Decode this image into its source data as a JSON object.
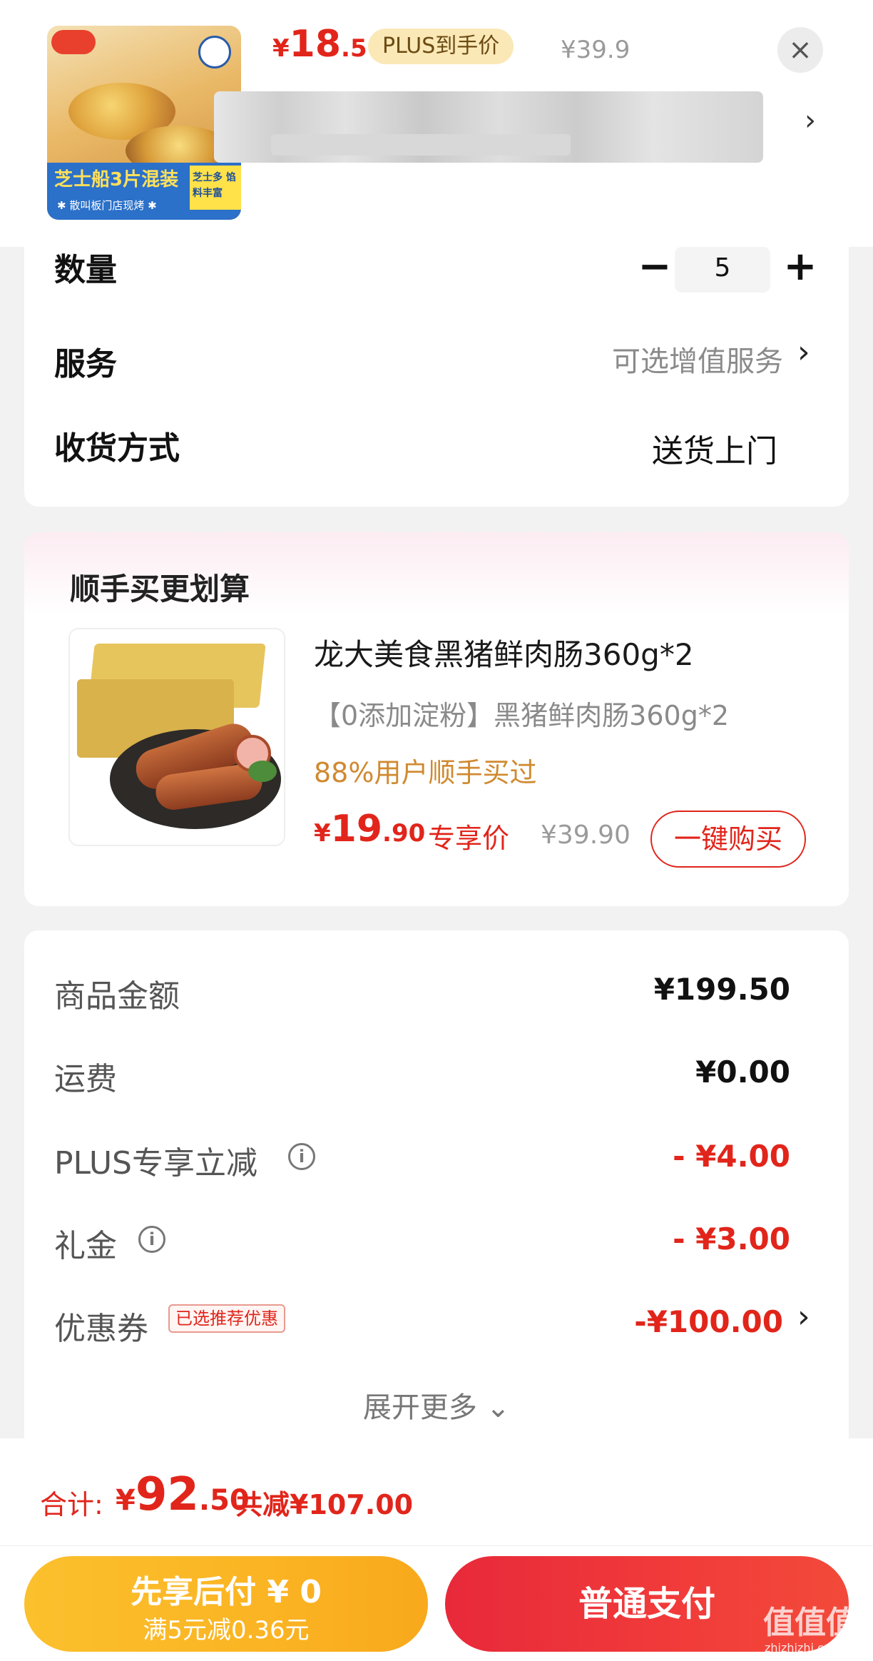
{
  "header": {
    "product_image_texts": {
      "banner_title": "芝士船3片混装",
      "banner_sub": "✱ 散叫板门店现烤 ✱",
      "side_tag": "芝士多 馅料丰富"
    },
    "price_currency": "¥",
    "price_integer": "18",
    "price_decimal": ".5",
    "plus_tag": "PLUS到手价",
    "original_price": "¥39.9",
    "close_icon": "×",
    "chevron": "›"
  },
  "options": {
    "quantity_label": "数量",
    "quantity_minus": "−",
    "quantity_value": "5",
    "quantity_plus": "+",
    "service_label": "服务",
    "service_value": "可选增值服务",
    "service_chevron": "›",
    "delivery_label": "收货方式",
    "delivery_value": "送货上门"
  },
  "suggestion": {
    "title": "顺手买更划算",
    "product_name": "龙大美食黑猪鲜肉肠360g*2",
    "product_desc": "【0添加淀粉】黑猪鲜肉肠360g*2",
    "purchase_rate": "88%用户顺手买过",
    "price_currency": "¥",
    "price_integer": "19",
    "price_decimal": ".90",
    "exclusive_label": "专享价",
    "original_price": "¥39.90",
    "buy_button": "一键购买"
  },
  "amounts": {
    "goods_label": "商品金额",
    "goods_value": "¥199.50",
    "shipping_label": "运费",
    "shipping_value": "¥0.00",
    "plus_discount_label": "PLUS专享立减",
    "plus_discount_value": "- ¥4.00",
    "gift_label": "礼金",
    "gift_value": "- ¥3.00",
    "coupon_label": "优惠券",
    "coupon_tag": "已选推荐优惠",
    "coupon_value": "-¥100.00",
    "coupon_chevron": "›",
    "expand_more": "展开更多 ⌄",
    "info_icon": "i"
  },
  "summary": {
    "total_label": "合计:",
    "total_currency": "¥",
    "total_integer": "92",
    "total_decimal": ".50",
    "total_saved": "共减¥107.00"
  },
  "actions": {
    "pay_later_title": "先享后付 ¥ 0",
    "pay_later_sub": "满5元减0.36元",
    "pay_button": "普通支付"
  },
  "watermark": {
    "text": "值值值",
    "sub": "zhizhizhi.com"
  },
  "colors": {
    "accent_red": "#e1251b",
    "gold": "#d08a30",
    "pay_later_yellow": "#fbc02d",
    "pay_red": "#e8293a"
  }
}
